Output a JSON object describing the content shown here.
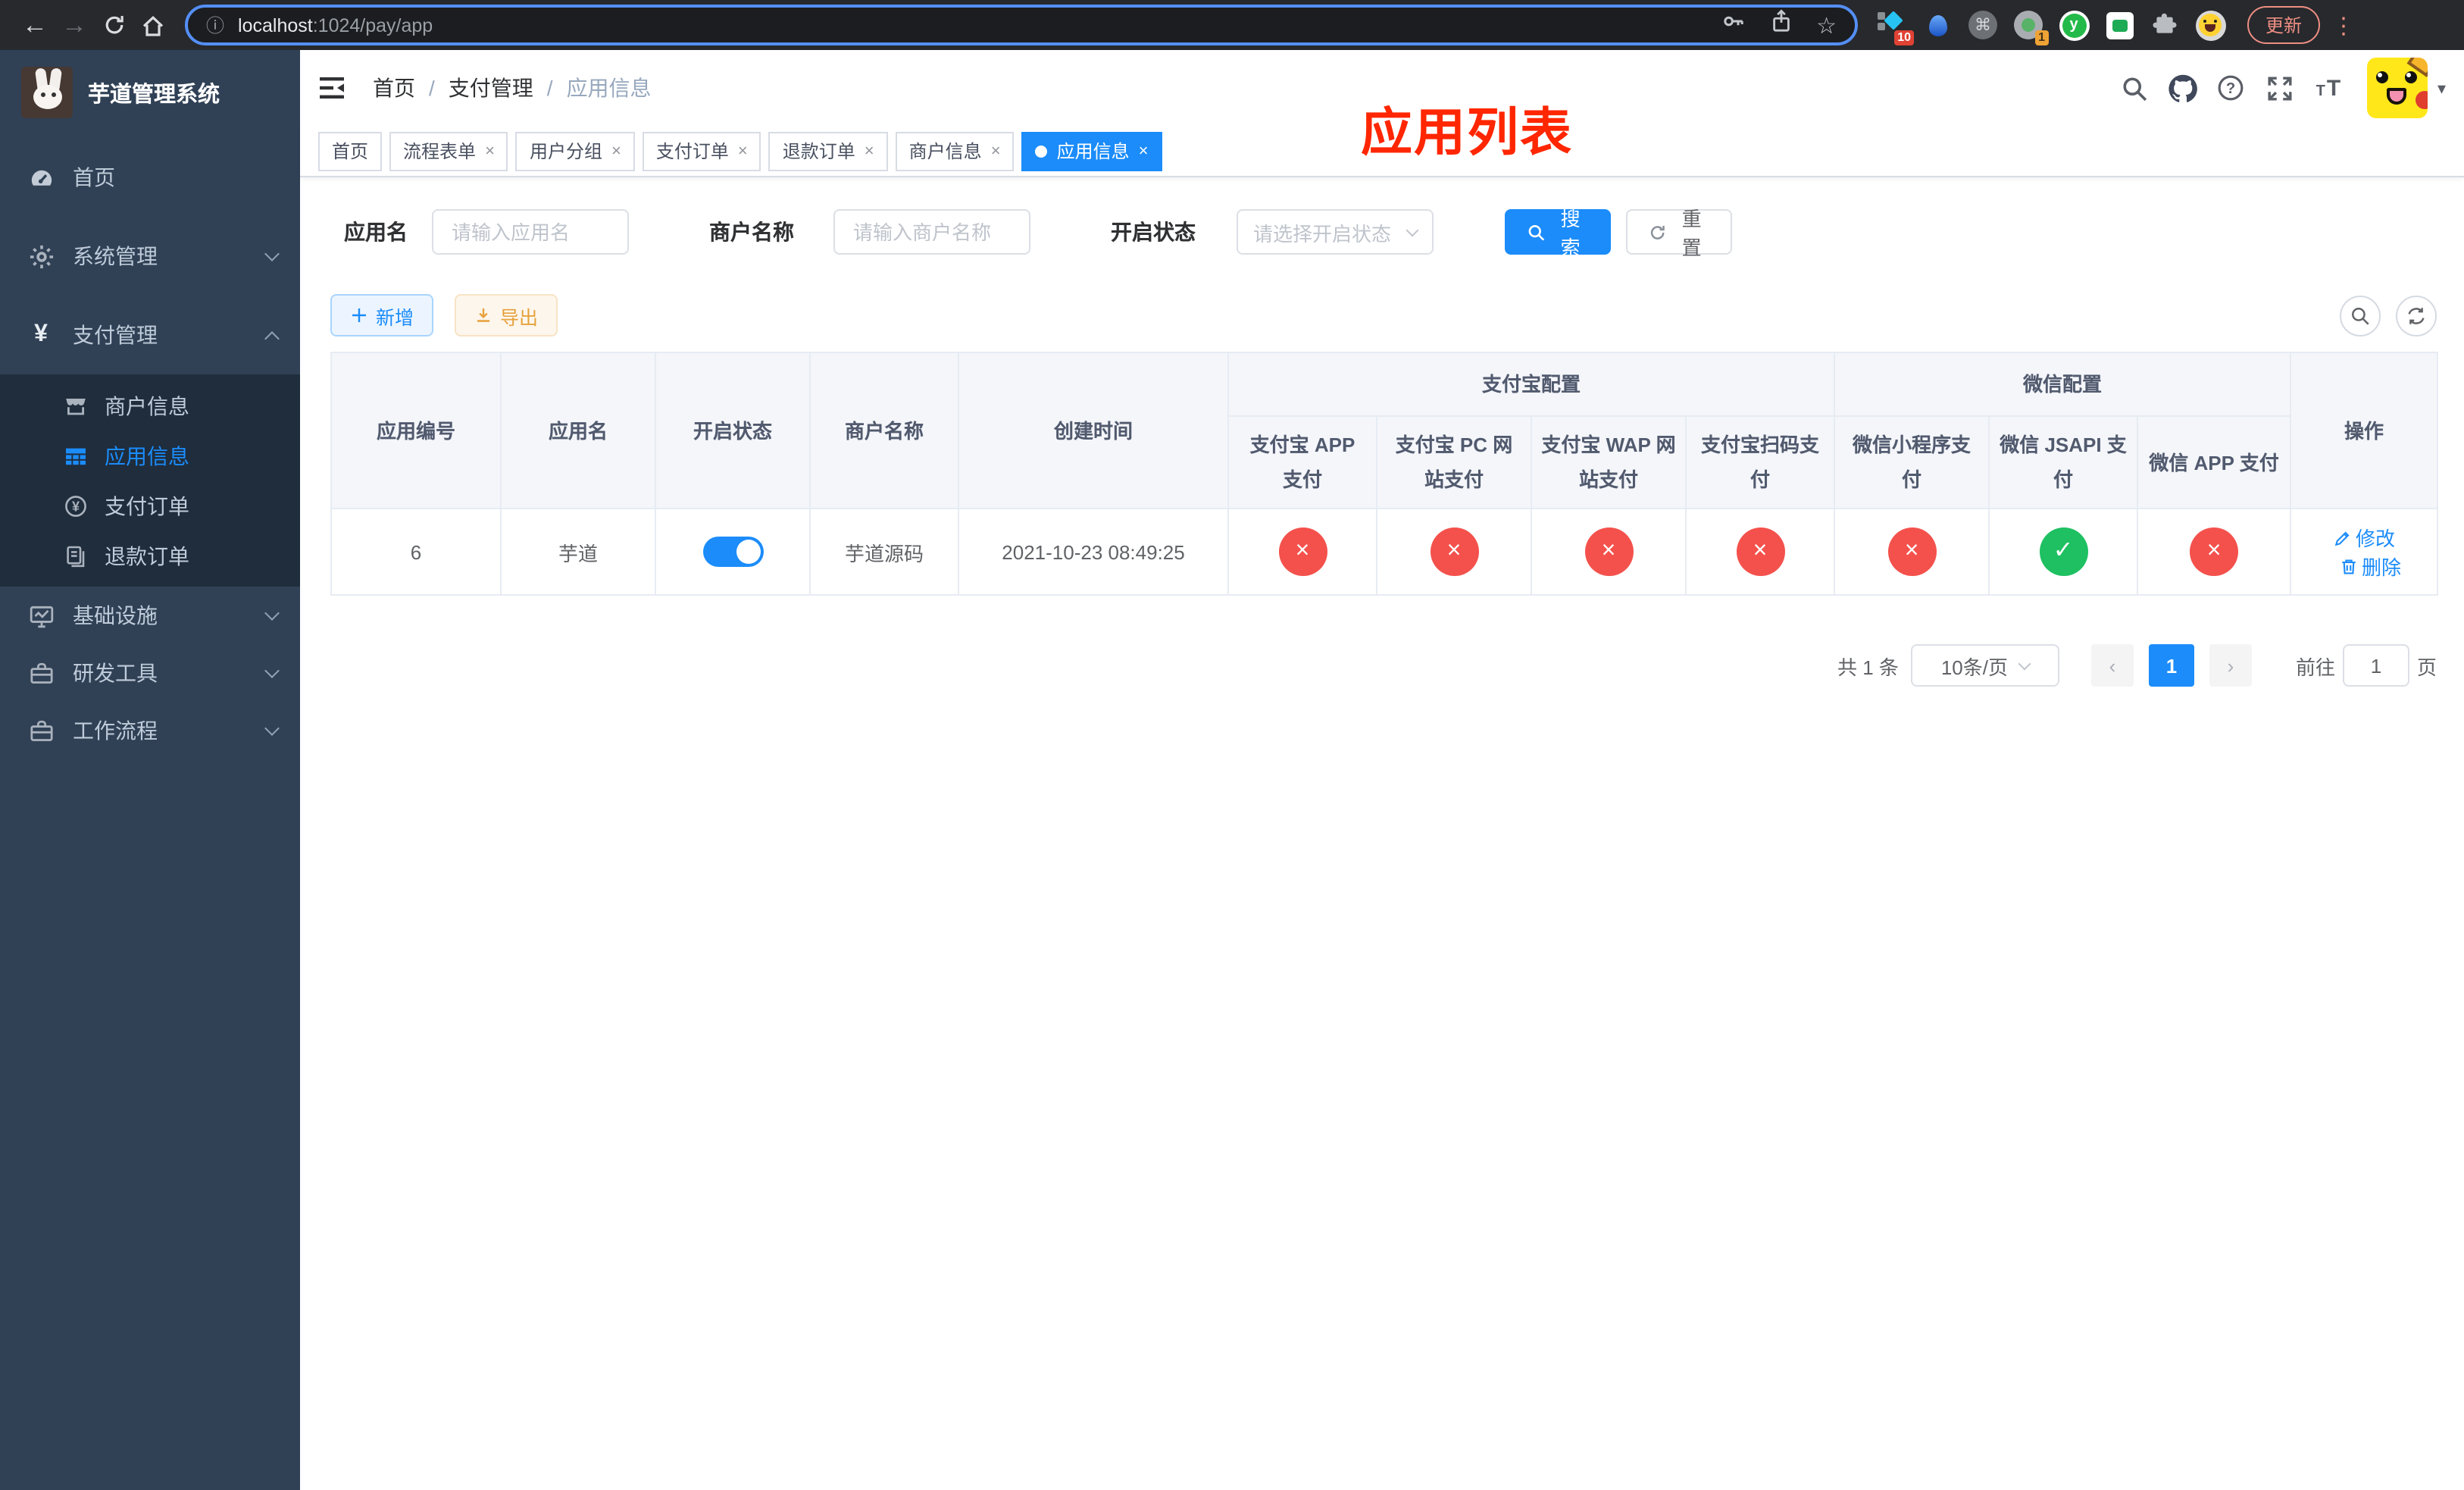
{
  "browser": {
    "url_host": "localhost",
    "url_path": ":1024/pay/app",
    "ext_badge_count": "10",
    "ext_badge_count2": "1",
    "ext_letter": "y",
    "update_label": "更新"
  },
  "sidebar": {
    "title": "芋道管理系统",
    "items": [
      {
        "label": "首页"
      },
      {
        "label": "系统管理"
      },
      {
        "label": "支付管理"
      },
      {
        "label": "商户信息"
      },
      {
        "label": "应用信息"
      },
      {
        "label": "支付订单"
      },
      {
        "label": "退款订单"
      },
      {
        "label": "基础设施"
      },
      {
        "label": "研发工具"
      },
      {
        "label": "工作流程"
      }
    ]
  },
  "header": {
    "breadcrumb": [
      "首页",
      "支付管理",
      "应用信息"
    ],
    "overlay_title": "应用列表"
  },
  "tabs": [
    {
      "label": "首页"
    },
    {
      "label": "流程表单"
    },
    {
      "label": "用户分组"
    },
    {
      "label": "支付订单"
    },
    {
      "label": "退款订单"
    },
    {
      "label": "商户信息"
    },
    {
      "label": "应用信息"
    }
  ],
  "filters": {
    "app_name_label": "应用名",
    "app_name_placeholder": "请输入应用名",
    "merchant_label": "商户名称",
    "merchant_placeholder": "请输入商户名称",
    "status_label": "开启状态",
    "status_placeholder": "请选择开启状态",
    "search_label": "搜索",
    "reset_label": "重置"
  },
  "toolbar": {
    "add_label": "新增",
    "export_label": "导出"
  },
  "table": {
    "headers": {
      "app_id": "应用编号",
      "app_name": "应用名",
      "status": "开启状态",
      "merchant": "商户名称",
      "created": "创建时间",
      "alipay_group": "支付宝配置",
      "wechat_group": "微信配置",
      "alipay_app": "支付宝 APP 支付",
      "alipay_pc": "支付宝 PC 网站支付",
      "alipay_wap": "支付宝 WAP 网站支付",
      "alipay_qr": "支付宝扫码支付",
      "wechat_lite": "微信小程序支付",
      "wechat_jsapi": "微信 JSAPI 支付",
      "wechat_app": "微信 APP 支付",
      "actions": "操作"
    },
    "row": {
      "app_id": "6",
      "app_name": "芋道",
      "enabled": true,
      "merchant": "芋道源码",
      "created": "2021-10-23 08:49:25",
      "statuses": [
        "no",
        "no",
        "no",
        "no",
        "no",
        "yes",
        "no"
      ],
      "edit_label": "修改",
      "delete_label": "删除"
    }
  },
  "pagination": {
    "total": "共 1 条",
    "page_size": "10条/页",
    "current_page": "1",
    "goto_label": "前往",
    "goto_value": "1",
    "unit_label": "页"
  },
  "colors": {
    "accent": "#1b8cfa",
    "danger": "#f4514c",
    "success": "#1ec061",
    "warning": "#e6a23c",
    "annotation": "#ff2600"
  }
}
